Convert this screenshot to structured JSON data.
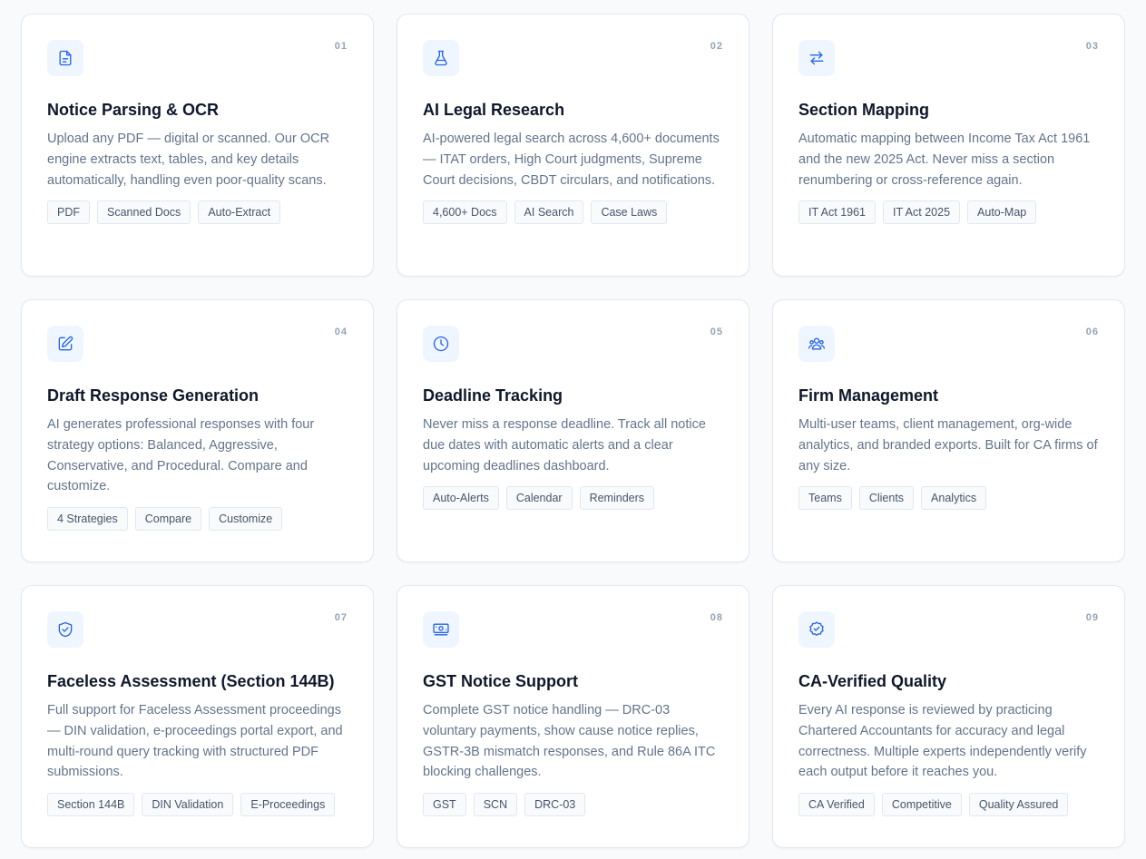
{
  "colors": {
    "accent": "#2563eb",
    "icon_bg": "#eff6ff",
    "title": "#0f172a",
    "muted": "#64748b",
    "number": "#94a3b8"
  },
  "features": [
    {
      "num": "01",
      "icon": "document-icon",
      "title": "Notice Parsing & OCR",
      "desc": "Upload any PDF — digital or scanned. Our OCR engine extracts text, tables, and key details automatically, handling even poor-quality scans.",
      "tags": [
        "PDF",
        "Scanned Docs",
        "Auto-Extract"
      ]
    },
    {
      "num": "02",
      "icon": "flask-icon",
      "title": "AI Legal Research",
      "desc": "AI-powered legal search across 4,600+ documents — ITAT orders, High Court judgments, Supreme Court decisions, CBDT circulars, and notifications.",
      "tags": [
        "4,600+ Docs",
        "AI Search",
        "Case Laws"
      ]
    },
    {
      "num": "03",
      "icon": "swap-arrows-icon",
      "title": "Section Mapping",
      "desc": "Automatic mapping between Income Tax Act 1961 and the new 2025 Act. Never miss a section renumbering or cross-reference again.",
      "tags": [
        "IT Act 1961",
        "IT Act 2025",
        "Auto-Map"
      ]
    },
    {
      "num": "04",
      "icon": "pencil-square-icon",
      "title": "Draft Response Generation",
      "desc": "AI generates professional responses with four strategy options: Balanced, Aggressive, Conservative, and Procedural. Compare and customize.",
      "tags": [
        "4 Strategies",
        "Compare",
        "Customize"
      ]
    },
    {
      "num": "05",
      "icon": "clock-icon",
      "title": "Deadline Tracking",
      "desc": "Never miss a response deadline. Track all notice due dates with automatic alerts and a clear upcoming deadlines dashboard.",
      "tags": [
        "Auto-Alerts",
        "Calendar",
        "Reminders"
      ]
    },
    {
      "num": "06",
      "icon": "users-group-icon",
      "title": "Firm Management",
      "desc": "Multi-user teams, client management, org-wide analytics, and branded exports. Built for CA firms of any size.",
      "tags": [
        "Teams",
        "Clients",
        "Analytics"
      ]
    },
    {
      "num": "07",
      "icon": "shield-check-icon",
      "title": "Faceless Assessment (Section 144B)",
      "desc": "Full support for Faceless Assessment proceedings — DIN validation, e-proceedings portal export, and multi-round query tracking with structured PDF submissions.",
      "tags": [
        "Section 144B",
        "DIN Validation",
        "E-Proceedings"
      ]
    },
    {
      "num": "08",
      "icon": "banknotes-icon",
      "title": "GST Notice Support",
      "desc": "Complete GST notice handling — DRC-03 voluntary payments, show cause notice replies, GSTR-3B mismatch responses, and Rule 86A ITC blocking challenges.",
      "tags": [
        "GST",
        "SCN",
        "DRC-03"
      ]
    },
    {
      "num": "09",
      "icon": "badge-check-icon",
      "title": "CA-Verified Quality",
      "desc": "Every AI response is reviewed by practicing Chartered Accountants for accuracy and legal correctness. Multiple experts independently verify each output before it reaches you.",
      "tags": [
        "CA Verified",
        "Competitive",
        "Quality Assured"
      ]
    }
  ]
}
